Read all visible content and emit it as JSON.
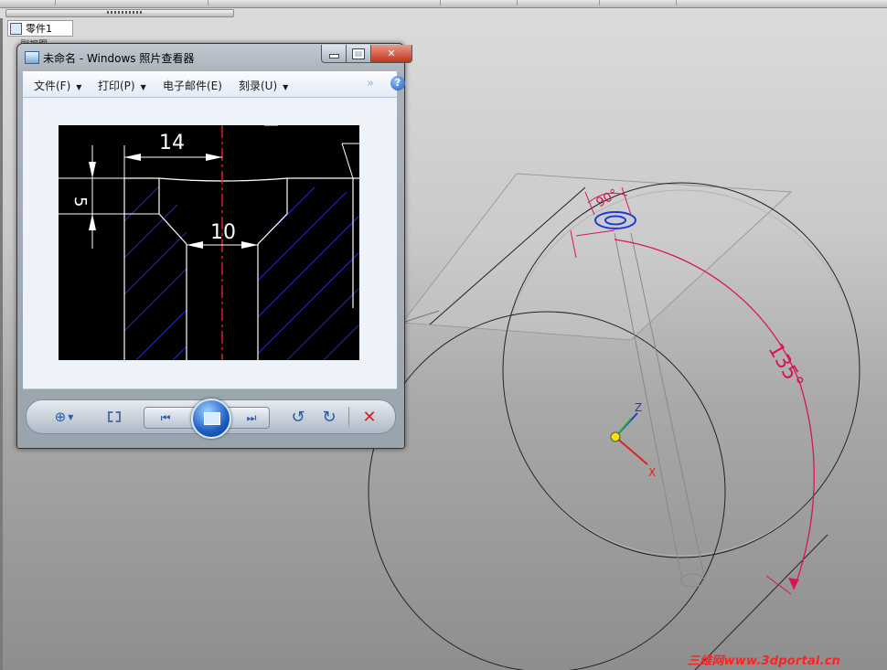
{
  "app": {
    "tree_root_label": "零件1",
    "tree_sub_label": "副视图"
  },
  "viewer": {
    "title": "未命名 - Windows 照片查看器",
    "menus": [
      {
        "label": "文件(F)"
      },
      {
        "label": "打印(P)"
      },
      {
        "label": "电子邮件(E)"
      },
      {
        "label": "刻录(U)"
      }
    ],
    "more_glyph": "»",
    "help_glyph": "?",
    "close_glyph": "✕"
  },
  "photo_drawing": {
    "dim_top": "14",
    "dim_left": "5",
    "dim_bottom": "10"
  },
  "scene": {
    "angle_top": "90°",
    "angle_main": "135°",
    "axis_z": "Z",
    "axis_x": "X"
  },
  "watermark": "三维网www.3dportal.cn",
  "colors": {
    "dimension_red": "#d8145a",
    "axis_blue": "#1c3cd6",
    "window_close": "#c0341b"
  }
}
